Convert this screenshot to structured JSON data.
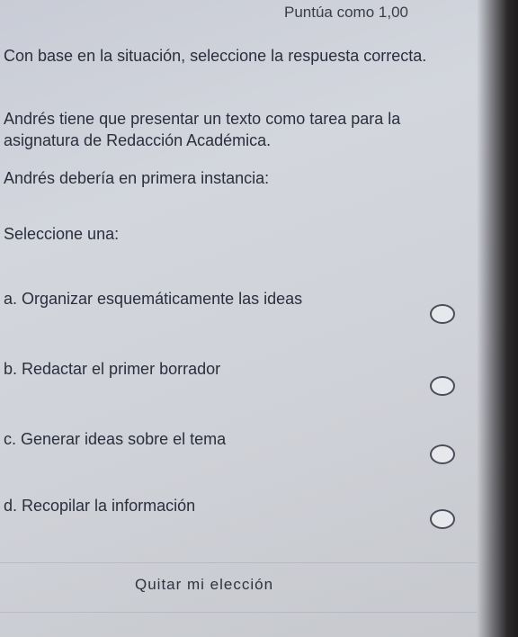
{
  "header": {
    "score": "Puntúa como 1,00"
  },
  "question": {
    "line1": "Con base en la situación, seleccione la respuesta correcta.",
    "line2": "Andrés tiene que presentar un texto como tarea para la asignatura de Redacción Académica.",
    "line3": "Andrés debería en primera instancia:"
  },
  "prompt": "Seleccione una:",
  "options": [
    {
      "label": "a. Organizar esquemáticamente las ideas",
      "selected": false
    },
    {
      "label": "b. Redactar el primer borrador",
      "selected": false
    },
    {
      "label": "c. Generar ideas sobre el tema",
      "selected": false
    },
    {
      "label": "d. Recopilar la información",
      "selected": false
    }
  ],
  "clear_label": "Quitar mi elección"
}
